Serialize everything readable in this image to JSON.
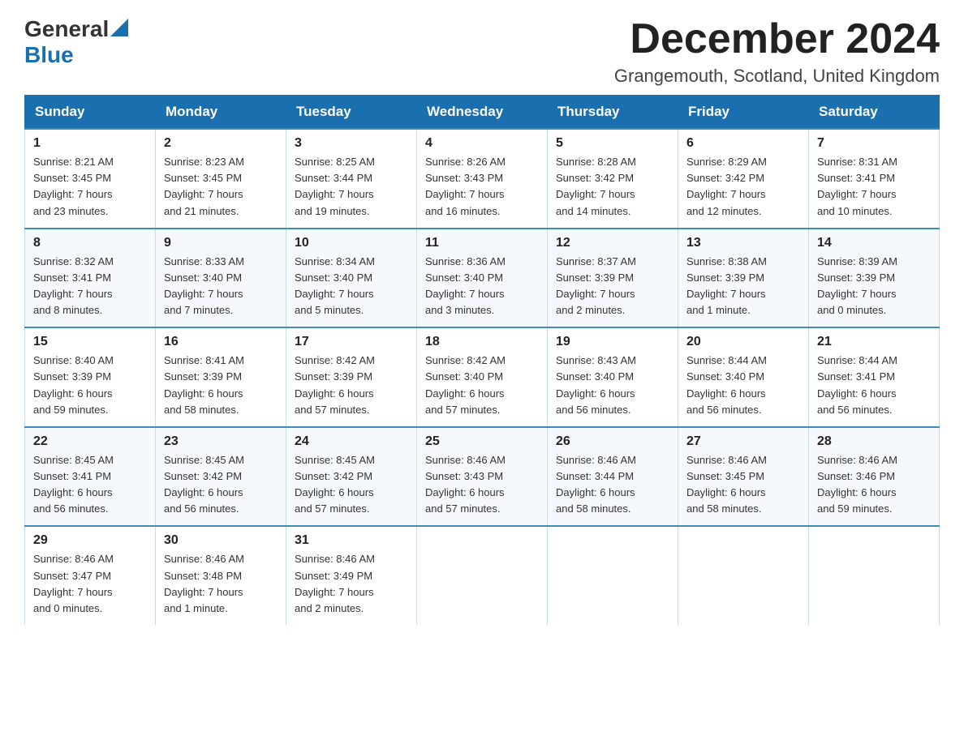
{
  "header": {
    "logo_general": "General",
    "logo_blue": "Blue",
    "month_title": "December 2024",
    "location": "Grangemouth, Scotland, United Kingdom"
  },
  "days_of_week": [
    "Sunday",
    "Monday",
    "Tuesday",
    "Wednesday",
    "Thursday",
    "Friday",
    "Saturday"
  ],
  "weeks": [
    [
      {
        "day": "1",
        "sunrise": "8:21 AM",
        "sunset": "3:45 PM",
        "daylight": "7 hours and 23 minutes."
      },
      {
        "day": "2",
        "sunrise": "8:23 AM",
        "sunset": "3:45 PM",
        "daylight": "7 hours and 21 minutes."
      },
      {
        "day": "3",
        "sunrise": "8:25 AM",
        "sunset": "3:44 PM",
        "daylight": "7 hours and 19 minutes."
      },
      {
        "day": "4",
        "sunrise": "8:26 AM",
        "sunset": "3:43 PM",
        "daylight": "7 hours and 16 minutes."
      },
      {
        "day": "5",
        "sunrise": "8:28 AM",
        "sunset": "3:42 PM",
        "daylight": "7 hours and 14 minutes."
      },
      {
        "day": "6",
        "sunrise": "8:29 AM",
        "sunset": "3:42 PM",
        "daylight": "7 hours and 12 minutes."
      },
      {
        "day": "7",
        "sunrise": "8:31 AM",
        "sunset": "3:41 PM",
        "daylight": "7 hours and 10 minutes."
      }
    ],
    [
      {
        "day": "8",
        "sunrise": "8:32 AM",
        "sunset": "3:41 PM",
        "daylight": "7 hours and 8 minutes."
      },
      {
        "day": "9",
        "sunrise": "8:33 AM",
        "sunset": "3:40 PM",
        "daylight": "7 hours and 7 minutes."
      },
      {
        "day": "10",
        "sunrise": "8:34 AM",
        "sunset": "3:40 PM",
        "daylight": "7 hours and 5 minutes."
      },
      {
        "day": "11",
        "sunrise": "8:36 AM",
        "sunset": "3:40 PM",
        "daylight": "7 hours and 3 minutes."
      },
      {
        "day": "12",
        "sunrise": "8:37 AM",
        "sunset": "3:39 PM",
        "daylight": "7 hours and 2 minutes."
      },
      {
        "day": "13",
        "sunrise": "8:38 AM",
        "sunset": "3:39 PM",
        "daylight": "7 hours and 1 minute."
      },
      {
        "day": "14",
        "sunrise": "8:39 AM",
        "sunset": "3:39 PM",
        "daylight": "7 hours and 0 minutes."
      }
    ],
    [
      {
        "day": "15",
        "sunrise": "8:40 AM",
        "sunset": "3:39 PM",
        "daylight": "6 hours and 59 minutes."
      },
      {
        "day": "16",
        "sunrise": "8:41 AM",
        "sunset": "3:39 PM",
        "daylight": "6 hours and 58 minutes."
      },
      {
        "day": "17",
        "sunrise": "8:42 AM",
        "sunset": "3:39 PM",
        "daylight": "6 hours and 57 minutes."
      },
      {
        "day": "18",
        "sunrise": "8:42 AM",
        "sunset": "3:40 PM",
        "daylight": "6 hours and 57 minutes."
      },
      {
        "day": "19",
        "sunrise": "8:43 AM",
        "sunset": "3:40 PM",
        "daylight": "6 hours and 56 minutes."
      },
      {
        "day": "20",
        "sunrise": "8:44 AM",
        "sunset": "3:40 PM",
        "daylight": "6 hours and 56 minutes."
      },
      {
        "day": "21",
        "sunrise": "8:44 AM",
        "sunset": "3:41 PM",
        "daylight": "6 hours and 56 minutes."
      }
    ],
    [
      {
        "day": "22",
        "sunrise": "8:45 AM",
        "sunset": "3:41 PM",
        "daylight": "6 hours and 56 minutes."
      },
      {
        "day": "23",
        "sunrise": "8:45 AM",
        "sunset": "3:42 PM",
        "daylight": "6 hours and 56 minutes."
      },
      {
        "day": "24",
        "sunrise": "8:45 AM",
        "sunset": "3:42 PM",
        "daylight": "6 hours and 57 minutes."
      },
      {
        "day": "25",
        "sunrise": "8:46 AM",
        "sunset": "3:43 PM",
        "daylight": "6 hours and 57 minutes."
      },
      {
        "day": "26",
        "sunrise": "8:46 AM",
        "sunset": "3:44 PM",
        "daylight": "6 hours and 58 minutes."
      },
      {
        "day": "27",
        "sunrise": "8:46 AM",
        "sunset": "3:45 PM",
        "daylight": "6 hours and 58 minutes."
      },
      {
        "day": "28",
        "sunrise": "8:46 AM",
        "sunset": "3:46 PM",
        "daylight": "6 hours and 59 minutes."
      }
    ],
    [
      {
        "day": "29",
        "sunrise": "8:46 AM",
        "sunset": "3:47 PM",
        "daylight": "7 hours and 0 minutes."
      },
      {
        "day": "30",
        "sunrise": "8:46 AM",
        "sunset": "3:48 PM",
        "daylight": "7 hours and 1 minute."
      },
      {
        "day": "31",
        "sunrise": "8:46 AM",
        "sunset": "3:49 PM",
        "daylight": "7 hours and 2 minutes."
      },
      null,
      null,
      null,
      null
    ]
  ],
  "labels": {
    "sunrise": "Sunrise:",
    "sunset": "Sunset:",
    "daylight": "Daylight:"
  }
}
